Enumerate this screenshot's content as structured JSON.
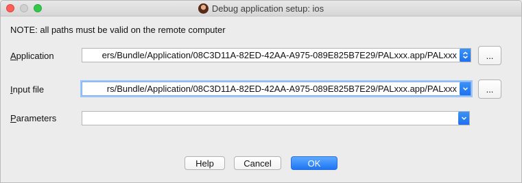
{
  "window": {
    "title": "Debug application setup: ios",
    "app_icon": "app-avatar-icon"
  },
  "note": "NOTE: all paths must be valid on the remote computer",
  "fields": {
    "application": {
      "label_underlined": "A",
      "label_rest": "pplication",
      "value": "ers/Bundle/Application/08C3D11A-82ED-42AA-A975-089E825B7E29/PALxxx.app/PALxxx",
      "browse_label": "..."
    },
    "input_file": {
      "label_underlined": "I",
      "label_rest": "nput file",
      "value": "rs/Bundle/Application/08C3D11A-82ED-42AA-A975-089E825B7E29/PALxxx.app/PALxxx",
      "browse_label": "..."
    },
    "parameters": {
      "label_underlined": "P",
      "label_rest": "arameters",
      "value": ""
    }
  },
  "buttons": {
    "help": "Help",
    "cancel": "Cancel",
    "ok": "OK"
  },
  "colors": {
    "accent": "#1d6ff0",
    "focus_ring": "#9fc6f8",
    "close": "#fc5f57",
    "maximize": "#34c84a"
  }
}
